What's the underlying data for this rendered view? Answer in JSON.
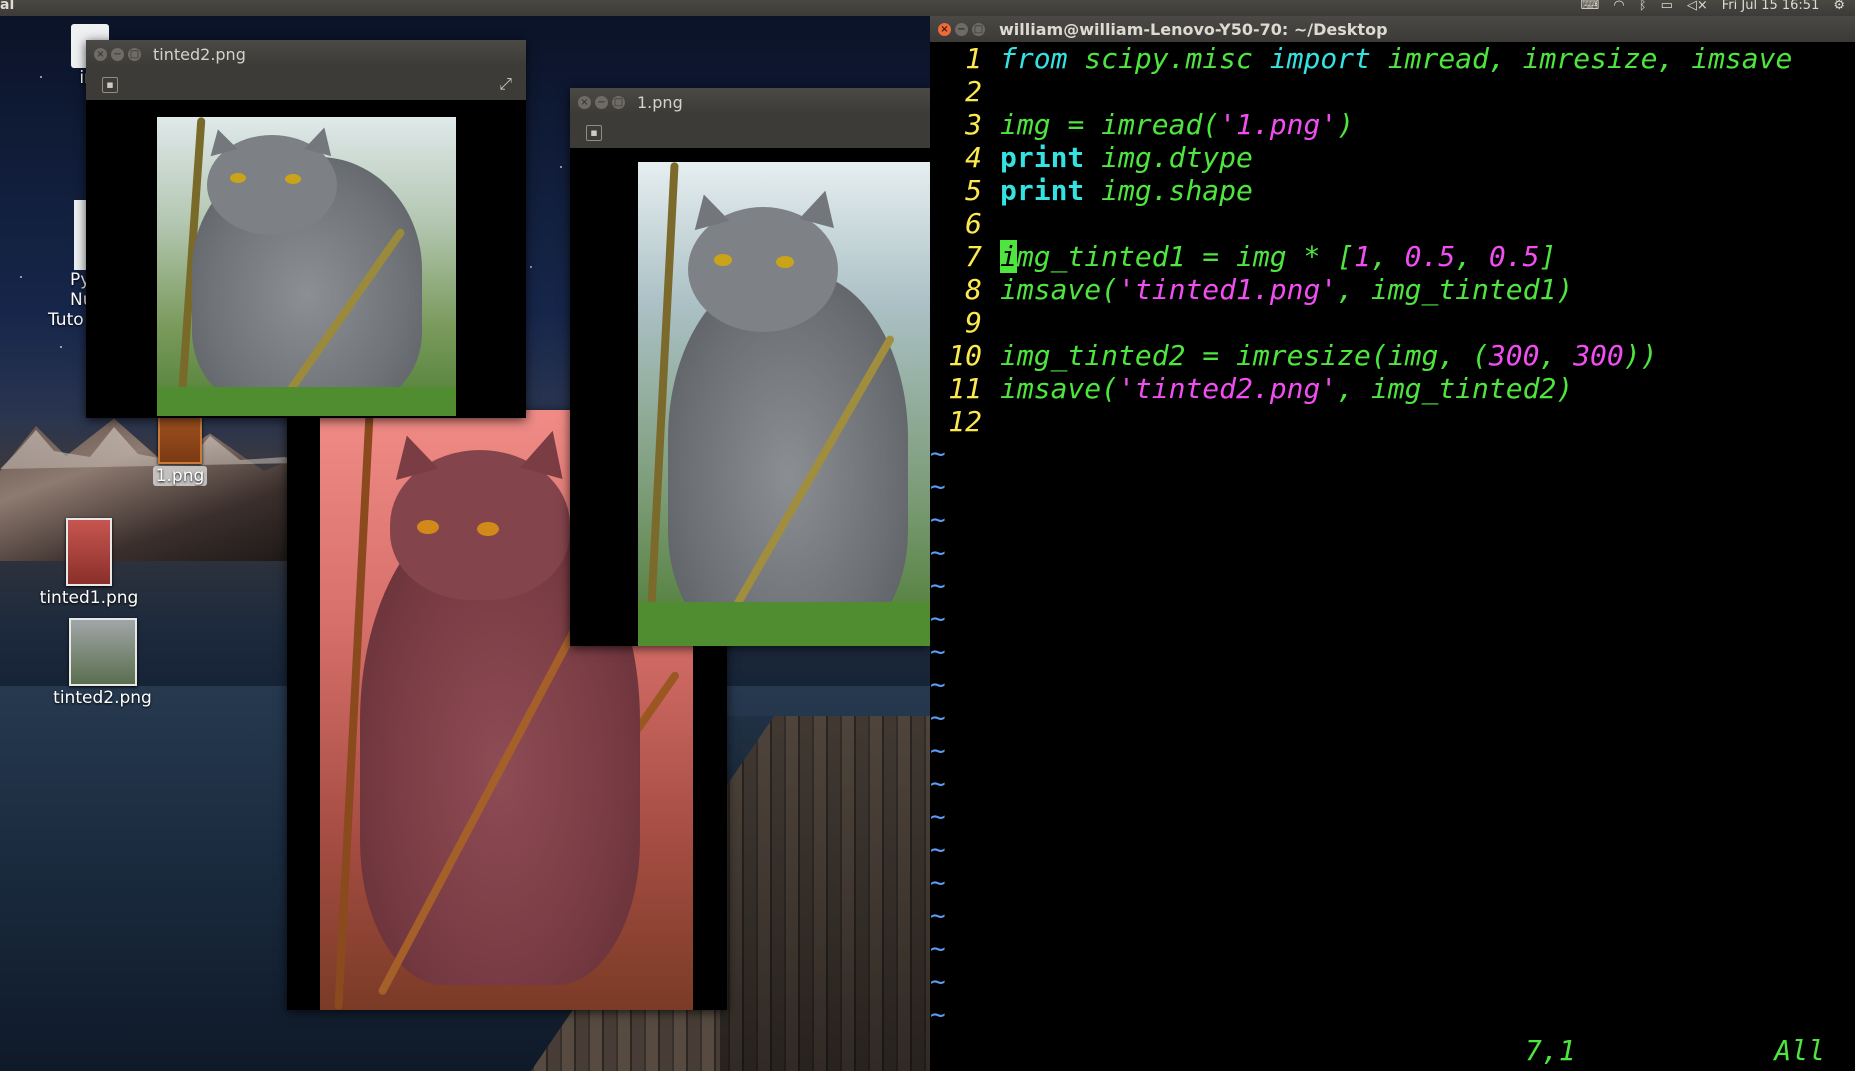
{
  "top_panel": {
    "app_fragment": "al",
    "clock": "Fri Jul 15 16:51"
  },
  "desktop": {
    "icons": [
      {
        "label": "im"
      },
      {
        "label_lines": [
          "Py",
          "Nu",
          "Tuto"
        ]
      },
      {
        "label": "1.png"
      },
      {
        "label": "tinted1.png"
      },
      {
        "label": "tinted2.png"
      }
    ]
  },
  "windows": {
    "tinted2": {
      "title": "tinted2.png"
    },
    "one": {
      "title": "1.png"
    }
  },
  "terminal": {
    "title": "william@william-Lenovo-Y50-70: ~/Desktop",
    "lines": [
      {
        "n": "1",
        "text": "from scipy.misc import imread, imresize, imsave"
      },
      {
        "n": "2",
        "text": ""
      },
      {
        "n": "3",
        "text": "img = imread('1.png')"
      },
      {
        "n": "4",
        "text": "print img.dtype"
      },
      {
        "n": "5",
        "text": "print img.shape"
      },
      {
        "n": "6",
        "text": ""
      },
      {
        "n": "7",
        "text": "img_tinted1 = img * [1, 0.5, 0.5]"
      },
      {
        "n": "8",
        "text": "imsave('tinted1.png', img_tinted1)"
      },
      {
        "n": "9",
        "text": ""
      },
      {
        "n": "10",
        "text": "img_tinted2 = imresize(img, (300, 300))"
      },
      {
        "n": "11",
        "text": "imsave('tinted2.png', img_tinted2)"
      },
      {
        "n": "12",
        "text": ""
      }
    ],
    "tilde": "~",
    "status_position": "7,1",
    "status_scroll": "All"
  }
}
